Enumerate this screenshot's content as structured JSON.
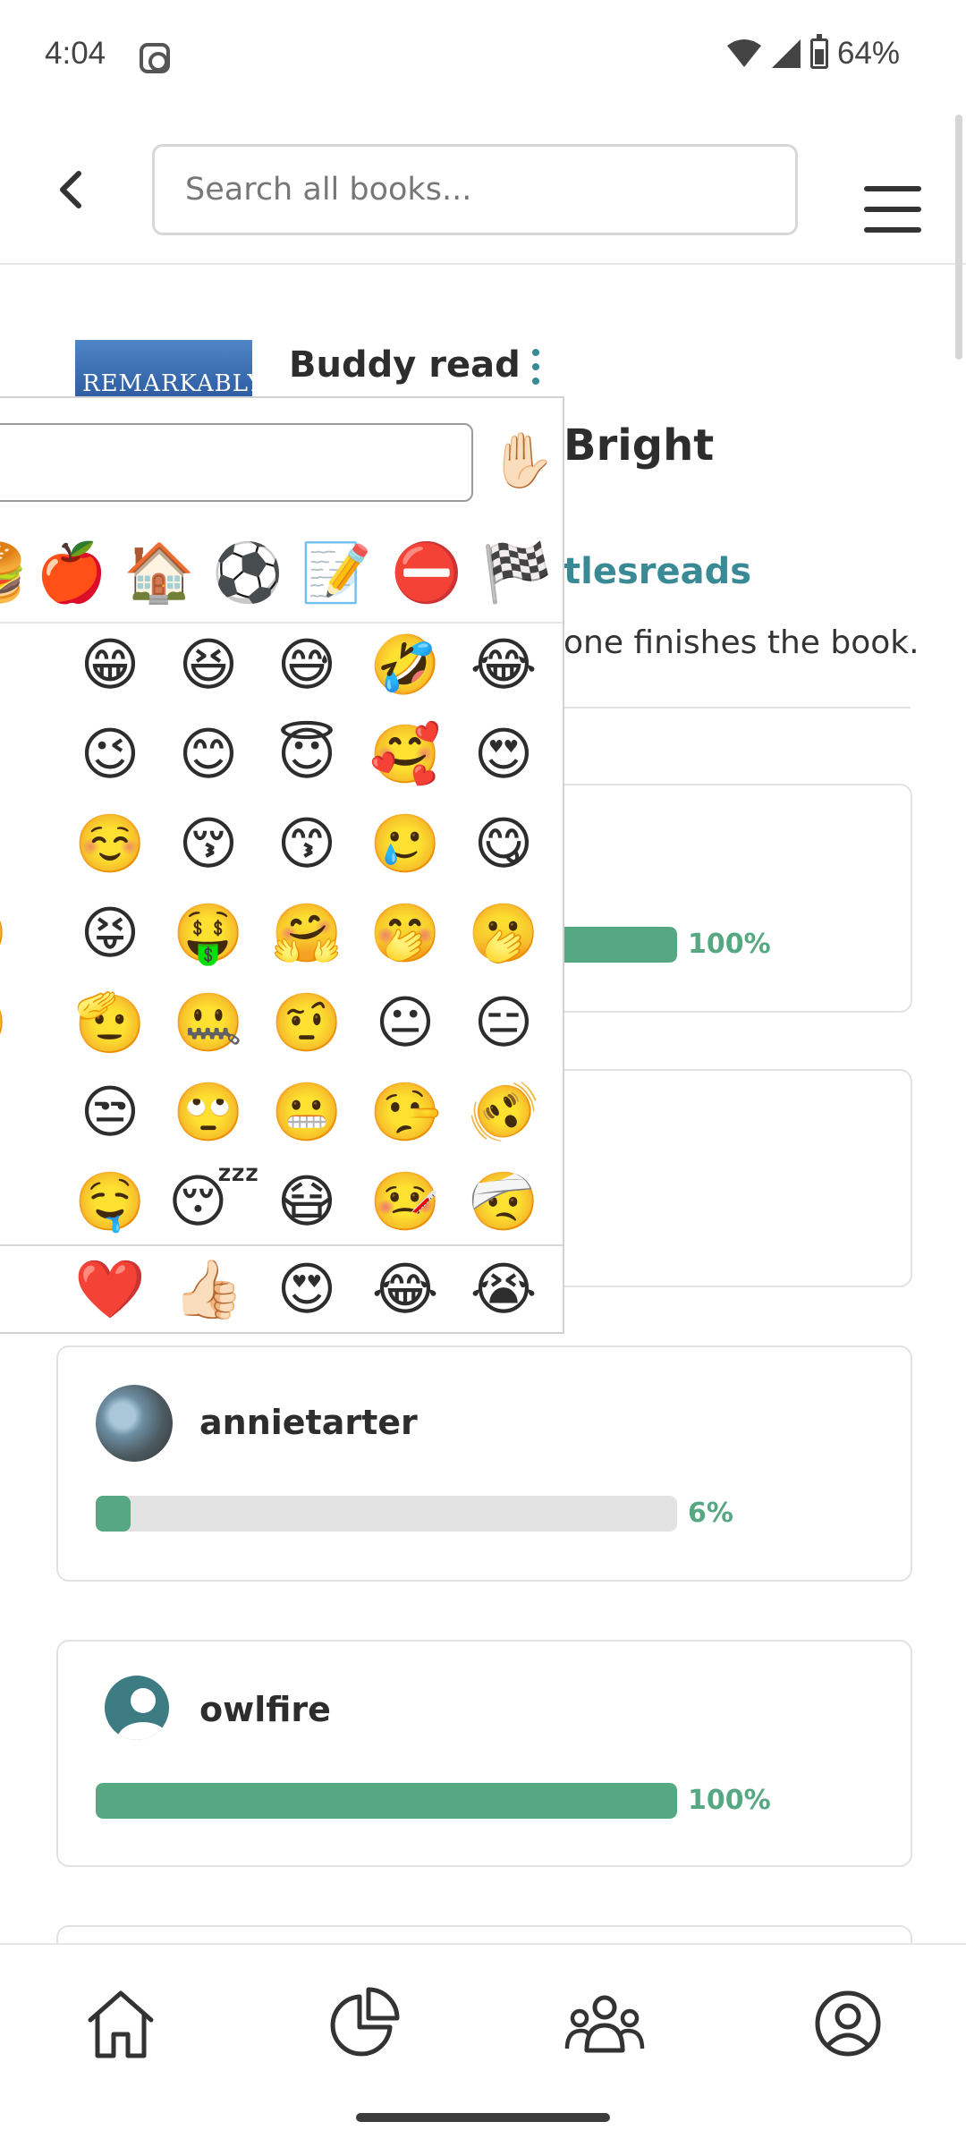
{
  "status_bar": {
    "time": "4:04",
    "battery": "64%"
  },
  "header": {
    "search_placeholder": "Search all books..."
  },
  "book": {
    "cover_text": "REMARKABLY",
    "buddy_read_label": "Buddy read",
    "title_visible": "Bright",
    "host_visible": "tlesreads",
    "description_visible": "one finishes the book."
  },
  "participants": [
    {
      "username": "annietarter",
      "progress_pct": "6%",
      "progress_value": 6
    },
    {
      "username": "owlfire",
      "progress_pct": "100%",
      "progress_value": 100
    }
  ],
  "hidden_cards": [
    {
      "progress_pct": "100%",
      "progress_value": 100
    }
  ],
  "emoji_picker": {
    "skin_tone_button": "✋🏻",
    "categories": [
      "🍎",
      "🏠",
      "⚽",
      "📝",
      "⛔",
      "🏁"
    ],
    "grid": [
      [
        "😄",
        "😁",
        "😆",
        "😅",
        "🤣",
        "😂"
      ],
      [
        "🫠",
        "😉",
        "😊",
        "😇",
        "🥰",
        "😍"
      ],
      [
        "😗",
        "☺️",
        "😚",
        "😙",
        "🥲",
        "😋"
      ],
      [
        "🤪",
        "😝",
        "🤑",
        "🤗",
        "🤭",
        "🫢"
      ],
      [
        "🤔",
        "🫡",
        "🤐",
        "🤨",
        "😐",
        "😑"
      ],
      [
        "😏",
        "😒",
        "🙄",
        "😬",
        "🤥",
        "🫨"
      ],
      [
        "😥",
        "🤤",
        "😴",
        "😷",
        "🤒",
        "🤕"
      ]
    ],
    "recent": [
      "😞",
      "❤️",
      "👍🏻",
      "😍",
      "😂",
      "😭"
    ]
  },
  "bottom_nav": [
    "home",
    "stats",
    "community",
    "profile"
  ]
}
